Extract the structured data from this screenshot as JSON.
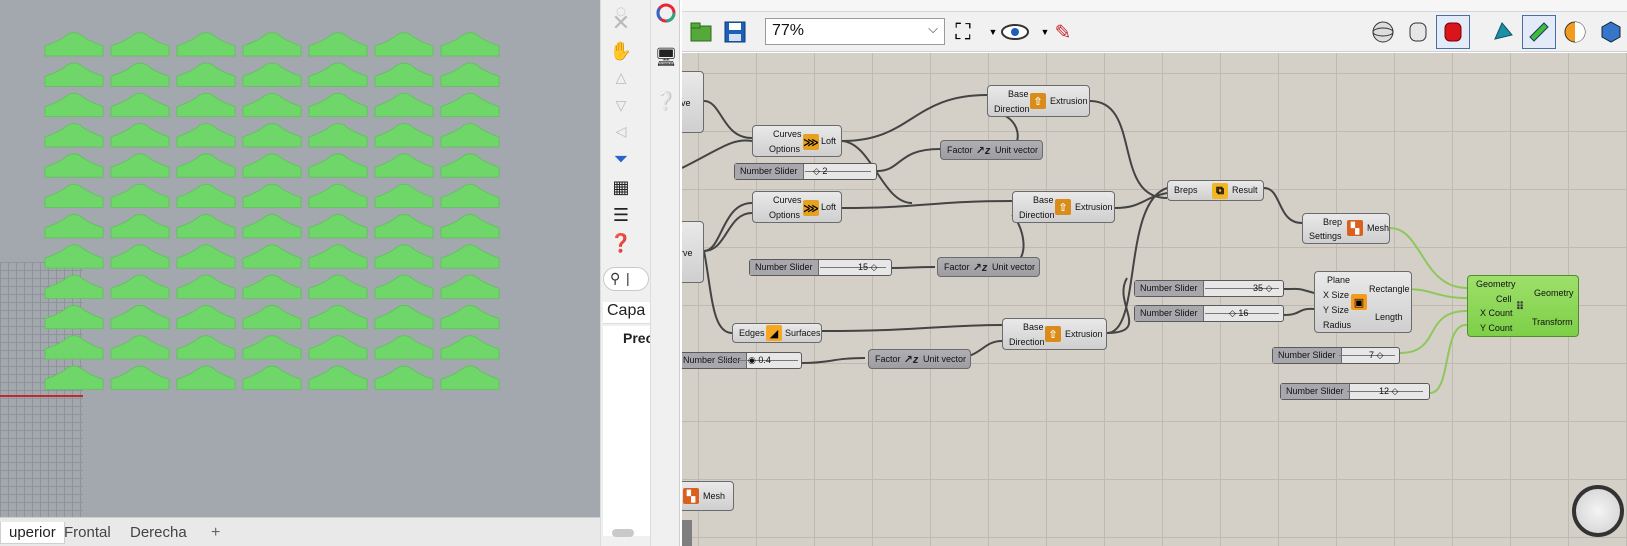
{
  "viewport": {
    "tabs": [
      "uperior",
      "Frontal",
      "Derecha"
    ],
    "add_tab_icon": "plus-icon",
    "shape_color": "#6fd66a",
    "bg_color": "#a3a8ae"
  },
  "side_panel": {
    "search_icon": "search-icon",
    "search_value": "|",
    "layers_title": "Capa",
    "layers_column_header": "Prec"
  },
  "gh_toolbar": {
    "zoom": "77%",
    "icons": [
      "open-file-icon",
      "save-file-icon",
      "zoom-extents-icon",
      "preview-eye-icon",
      "sketch-pen-icon",
      "preview-mode-icons"
    ]
  },
  "components": {
    "crv_top_out": "ve",
    "crv_mid_out": "urve",
    "loft1": {
      "in1": "Curves",
      "in2": "Options",
      "out": "Loft"
    },
    "loft2": {
      "in1": "Curves",
      "in2": "Options",
      "out": "Loft"
    },
    "ext1": {
      "in1": "Base",
      "in2": "Direction",
      "out": "Extrusion"
    },
    "ext2": {
      "in1": "Base",
      "in2": "Direction",
      "out": "Extrusion"
    },
    "ext3": {
      "in1": "Base",
      "in2": "Direction",
      "out": "Extrusion"
    },
    "unit1": {
      "in": "Factor",
      "out": "Unit vector"
    },
    "unit2": {
      "in": "Factor",
      "out": "Unit vector"
    },
    "unit3": {
      "in": "Factor",
      "out": "Unit vector"
    },
    "union": {
      "in": "Breps",
      "out": "Result"
    },
    "mesh": {
      "in1": "Brep",
      "in2": "Settings",
      "out": "Mesh"
    },
    "edges": {
      "in": "Edges",
      "out": "Surfaces"
    },
    "rect": {
      "in1": "Plane",
      "in2": "X Size",
      "in3": "Y Size",
      "in4": "Radius",
      "out1": "Rectangle",
      "out2": "Length"
    },
    "array": {
      "in1": "Geometry",
      "in2": "Cell",
      "in3": "X Count",
      "in4": "Y Count",
      "out1": "Geometry",
      "out2": "Transform"
    },
    "mesh_bottom": {
      "out": "Mesh"
    }
  },
  "sliders": [
    {
      "label": "Number Slider",
      "value": "2"
    },
    {
      "label": "Number Slider",
      "value": "15"
    },
    {
      "label": "Number Slider",
      "value": "0.4"
    },
    {
      "label": "Number Slider",
      "value": "35"
    },
    {
      "label": "Number Slider",
      "value": "16"
    },
    {
      "label": "Number Slider",
      "value": "7"
    },
    {
      "label": "Number Slider",
      "value": "12"
    }
  ]
}
